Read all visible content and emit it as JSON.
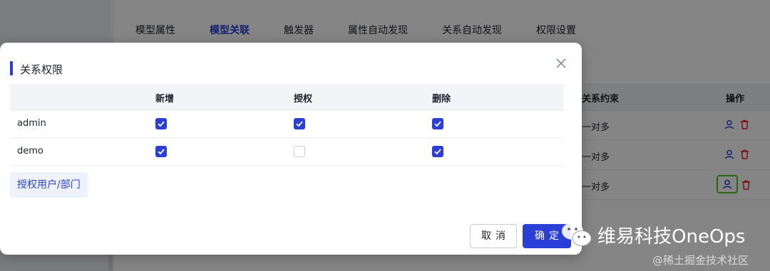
{
  "background": {
    "tabs": [
      {
        "label": "模型属性",
        "active": false
      },
      {
        "label": "模型关联",
        "active": true
      },
      {
        "label": "触发器",
        "active": false
      },
      {
        "label": "属性自动发现",
        "active": false
      },
      {
        "label": "关系自动发现",
        "active": false
      },
      {
        "label": "权限设置",
        "active": false
      }
    ],
    "table": {
      "columns": [
        "关系约束",
        "操作"
      ],
      "rows": [
        {
          "constraint": "一对多",
          "icons": [
            "user-icon",
            "trash-icon"
          ]
        },
        {
          "constraint": "一对多",
          "icons": [
            "user-icon",
            "trash-icon"
          ]
        },
        {
          "constraint": "一对多",
          "icons": [
            "user-icon",
            "trash-icon"
          ],
          "highlighted": true
        }
      ]
    }
  },
  "modal": {
    "title": "关系权限",
    "close_icon": "close-icon",
    "table": {
      "headers": [
        "",
        "新增",
        "授权",
        "删除"
      ],
      "rows": [
        {
          "name": "admin",
          "add": true,
          "grant": true,
          "delete": true
        },
        {
          "name": "demo",
          "add": true,
          "grant": false,
          "delete": true
        }
      ]
    },
    "auth_button_label": "授权用户/部门",
    "cancel_label": "取消",
    "ok_label": "确定"
  },
  "watermark": {
    "brand": "维易科技OneOps",
    "sub": "@稀土掘金技术社区",
    "icon": "wechat-icon"
  },
  "colors": {
    "accent": "#2b3fd6",
    "danger": "#e0282e",
    "highlight": "#52c41a"
  }
}
